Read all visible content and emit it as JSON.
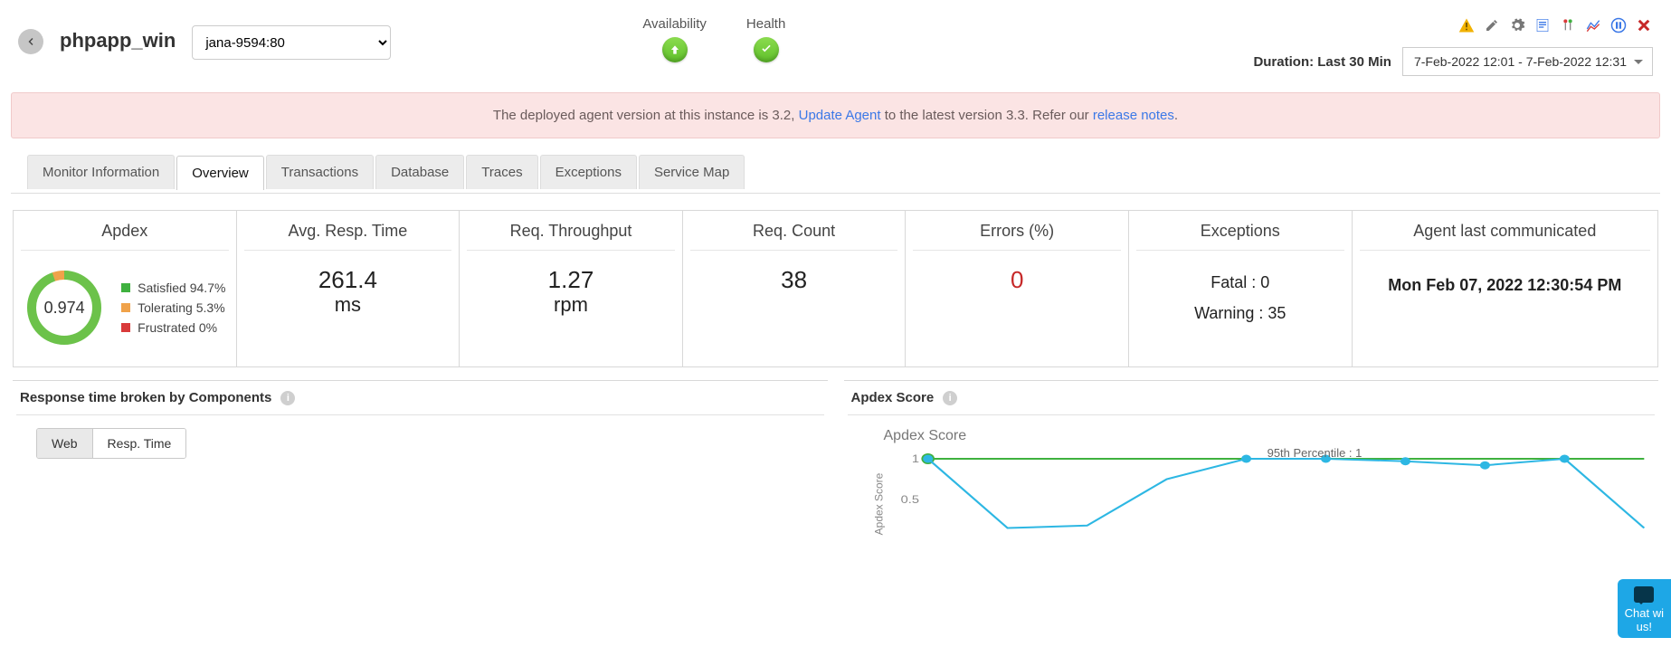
{
  "header": {
    "app_name": "phpapp_win",
    "selected_instance": "jana-9594:80",
    "availability_label": "Availability",
    "health_label": "Health",
    "duration_label": "Duration: Last 30 Min",
    "date_range": "7-Feb-2022 12:01 - 7-Feb-2022 12:31"
  },
  "toolbar_icons": [
    "warning-icon",
    "edit-icon",
    "settings-icon",
    "export-icon",
    "flag-icon",
    "chart-icon",
    "pause-icon",
    "delete-icon"
  ],
  "banner": {
    "prefix": "The deployed agent version at this instance is 3.2, ",
    "link1": "Update Agent",
    "mid": " to the latest version 3.3. Refer our ",
    "link2": "release notes",
    "suffix": "."
  },
  "tabs": [
    "Monitor Information",
    "Overview",
    "Transactions",
    "Database",
    "Traces",
    "Exceptions",
    "Service Map"
  ],
  "active_tab": "Overview",
  "kpi": {
    "apdex": {
      "title": "Apdex",
      "score": "0.974",
      "legend": [
        {
          "label": "Satisfied 94.7%",
          "color": "#3fb13f"
        },
        {
          "label": "Tolerating 5.3%",
          "color": "#f0a24a"
        },
        {
          "label": "Frustrated 0%",
          "color": "#d93a3a"
        }
      ]
    },
    "avg_resp": {
      "title": "Avg. Resp. Time",
      "value": "261.4",
      "unit": "ms"
    },
    "throughput": {
      "title": "Req. Throughput",
      "value": "1.27",
      "unit": "rpm"
    },
    "req_count": {
      "title": "Req. Count",
      "value": "38"
    },
    "errors": {
      "title": "Errors (%)",
      "value": "0"
    },
    "exceptions": {
      "title": "Exceptions",
      "fatal": "Fatal : 0",
      "warning": "Warning : 35"
    },
    "agent": {
      "title": "Agent last communicated",
      "value": "Mon Feb 07, 2022 12:30:54 PM"
    }
  },
  "left_panel": {
    "title": "Response time broken by Components",
    "segments": [
      "Web",
      "Resp. Time"
    ],
    "active_segment": "Web"
  },
  "right_panel": {
    "title": "Apdex Score",
    "chart_title": "Apdex Score",
    "y_label": "Apdex Score",
    "annotation": "95th Percentile : 1"
  },
  "chat": {
    "line1": "Chat wi",
    "line2": "us!"
  },
  "chart_data": {
    "type": "line",
    "title": "Apdex Score",
    "xlabel": "",
    "ylabel": "Apdex Score",
    "ylim": [
      0,
      1
    ],
    "y_ticks": [
      0.5,
      1
    ],
    "series": [
      {
        "name": "Apdex",
        "color": "#2db7e3",
        "x": [
          0,
          1,
          2,
          3,
          4,
          5,
          6,
          7,
          8,
          9
        ],
        "y": [
          1.0,
          0.15,
          0.18,
          0.75,
          1.0,
          1.0,
          0.97,
          0.92,
          1.0,
          0.15
        ]
      }
    ],
    "annotations": [
      {
        "text": "95th Percentile : 1",
        "x": 5.5,
        "y": 1
      }
    ],
    "reference_line": {
      "y": 1,
      "color": "#3fb13f"
    }
  }
}
